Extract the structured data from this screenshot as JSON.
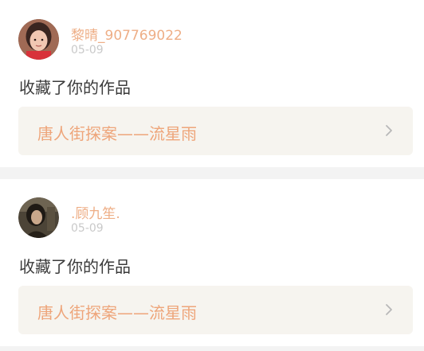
{
  "feed": [
    {
      "username": "黎晴_907769022",
      "date": "05-09",
      "action": "收藏了你的作品",
      "work_title": "唐人街探案——流星雨",
      "avatar_icon": "user-avatar-photo",
      "chevron_icon": "chevron-right-icon"
    },
    {
      "username": ".顾九笙.",
      "date": "05-09",
      "action": "收藏了你的作品",
      "work_title": "唐人街探案——流星雨",
      "avatar_icon": "user-avatar-photo",
      "chevron_icon": "chevron-right-icon"
    }
  ],
  "colors": {
    "page_background": "#f3f3f3",
    "card_background": "#ffffff",
    "username": "#eeae86",
    "date": "#c9c9c9",
    "action_text": "#3b3b3b",
    "work_link_background": "#f6f4ef",
    "work_title": "#eea57a",
    "chevron": "#b8b8b8"
  }
}
